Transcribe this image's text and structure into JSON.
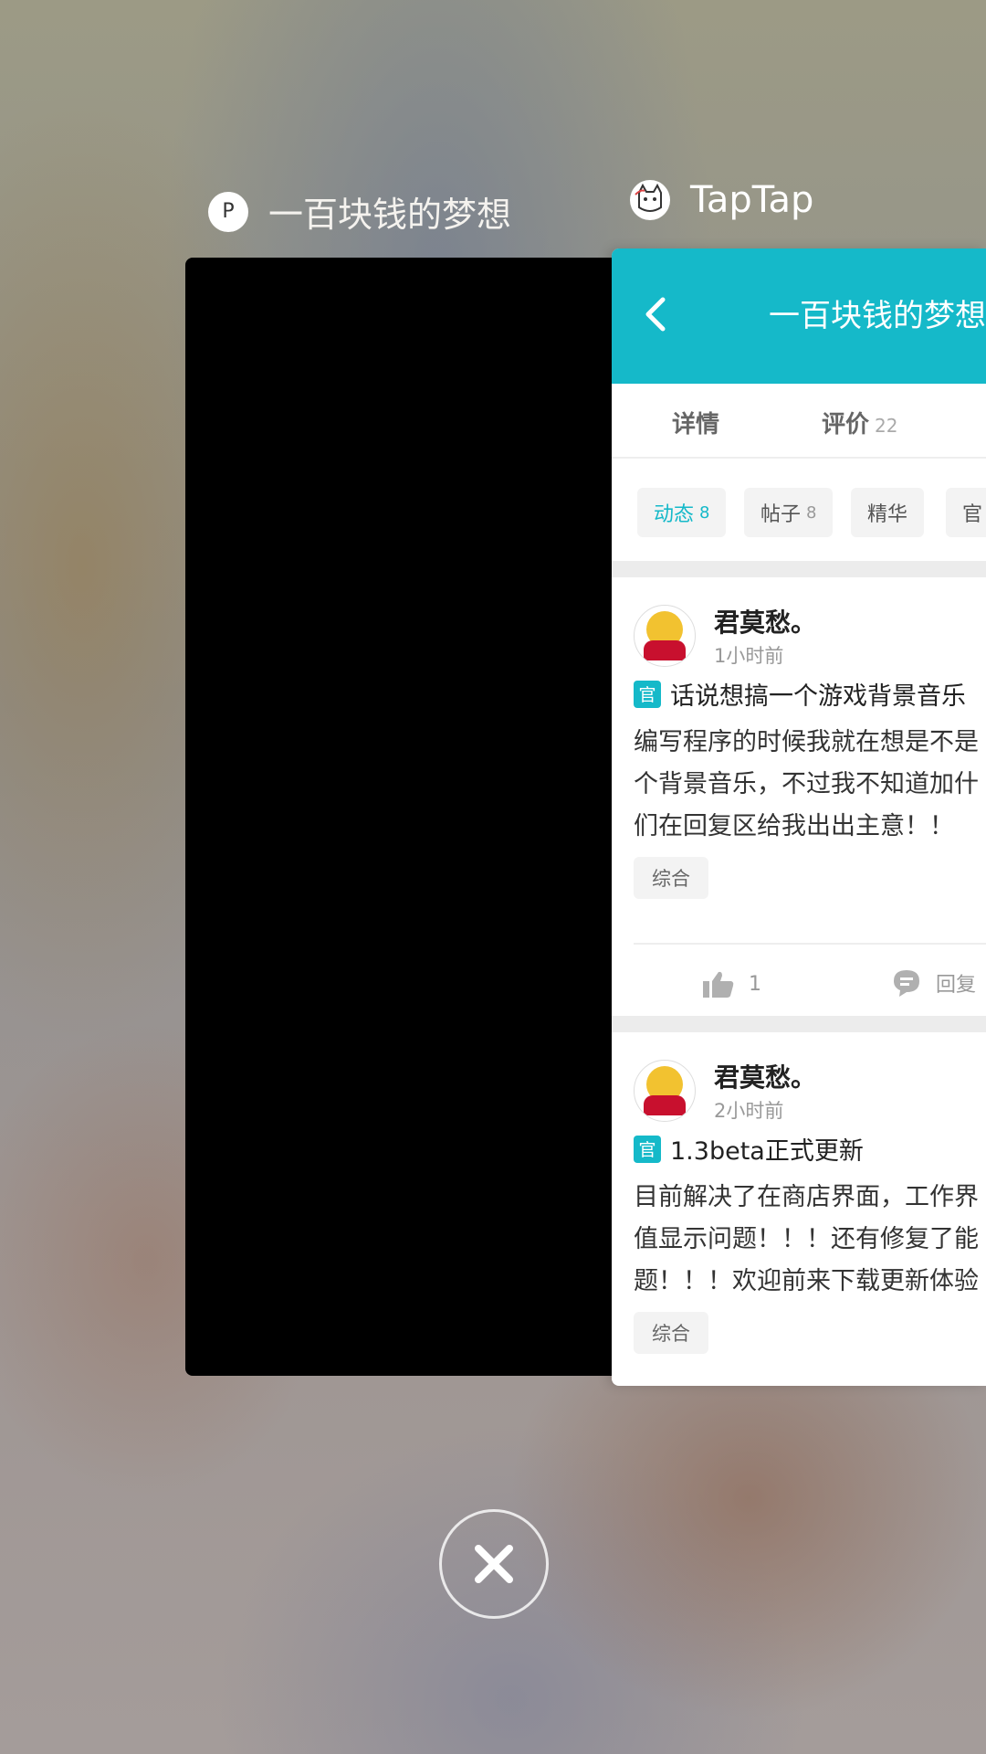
{
  "recents": {
    "left_app": {
      "title": "一百块钱的梦想",
      "icon": "app-icon"
    },
    "right_app": {
      "title": "TapTap",
      "icon": "taptap-cat-icon"
    }
  },
  "taptap": {
    "header": {
      "title": "一百块钱的梦想",
      "back_icon": "chevron-left-icon"
    },
    "tabs": [
      {
        "label": "详情",
        "count": ""
      },
      {
        "label": "评价",
        "count": "22"
      }
    ],
    "chips": [
      {
        "label": "动态",
        "count": "8",
        "active": true
      },
      {
        "label": "帖子",
        "count": "8",
        "active": false
      },
      {
        "label": "精华",
        "count": "",
        "active": false
      },
      {
        "label": "官",
        "count": "",
        "active": false
      }
    ],
    "posts": [
      {
        "author": "君莫愁。",
        "time": "1小时前",
        "badge": "官",
        "title": "话说想搞一个游戏背景音乐",
        "body": "编写程序的时候我就在想是不是\n个背景音乐，不过我不知道加什\n们在回复区给我出出主意！！",
        "tag": "综合",
        "likes": "1",
        "reply_label": "回复"
      },
      {
        "author": "君莫愁。",
        "time": "2小时前",
        "badge": "官",
        "title": "1.3beta正式更新",
        "body": "目前解决了在商店界面，工作界\n值显示问题！！！还有修复了能\n题！！！欢迎前来下载更新体验",
        "tag": "综合"
      }
    ]
  },
  "colors": {
    "accent": "#15b9c9"
  },
  "close_icon": "close-icon"
}
